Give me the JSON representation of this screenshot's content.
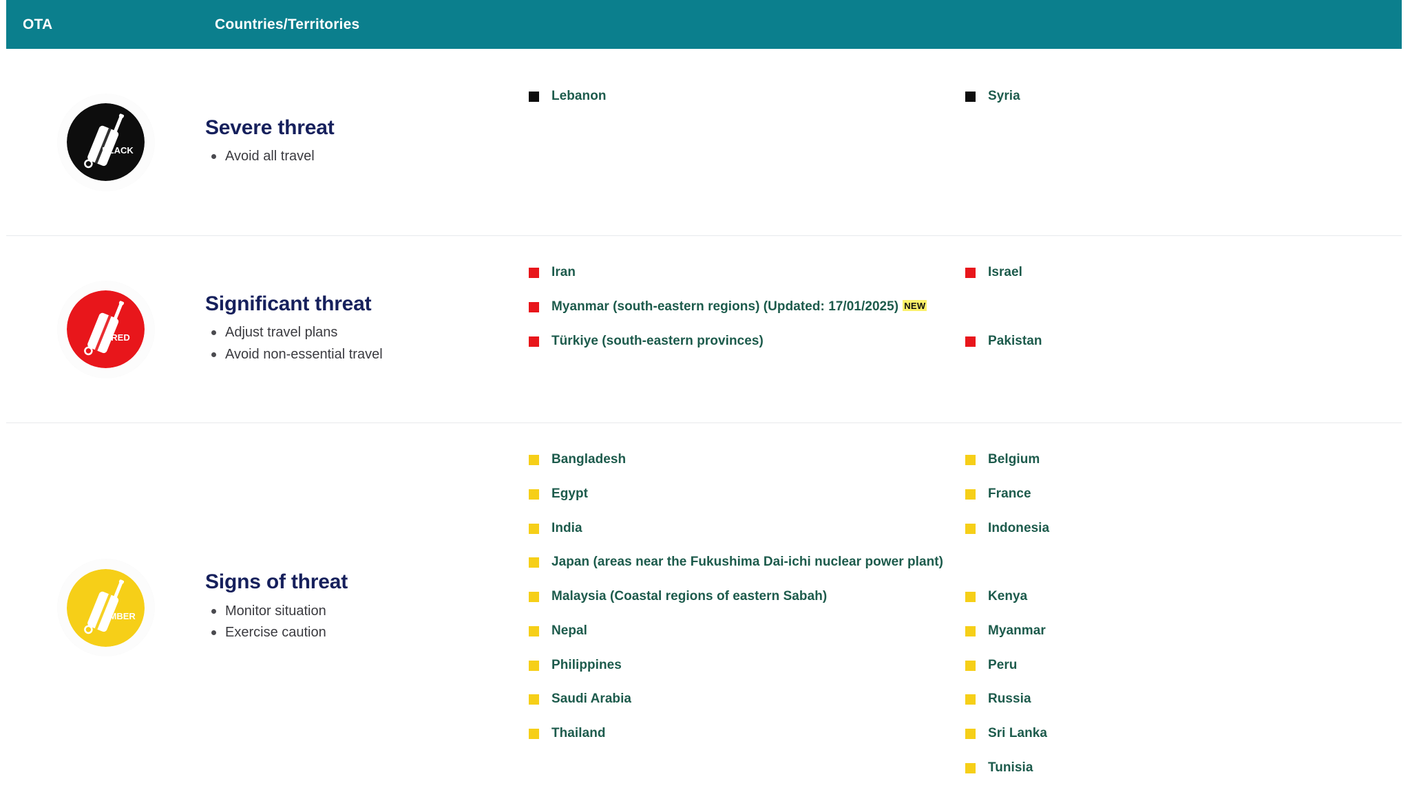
{
  "header": {
    "col_ota": "OTA",
    "col_countries": "Countries/Territories",
    "background_color": "#0b7f8d",
    "text_color": "#ffffff"
  },
  "colors": {
    "teal_header": "#0b7f8d",
    "heading_navy": "#16205c",
    "country_green": "#1d5b4c",
    "black_level": "#0d0d0d",
    "red_level": "#e8161b",
    "amber_level": "#f6cf18",
    "new_badge_highlight": "#faf06a",
    "divider": "#e7e9ec"
  },
  "rows": [
    {
      "id": "severe",
      "icon_name": "ota-badge-black-suitcase-icon",
      "icon_label": "BLACK",
      "icon_color": "#0d0d0d",
      "title": "Severe threat",
      "advice": [
        "Avoid all travel"
      ],
      "marker": "black",
      "columns": [
        {
          "entries": [
            {
              "name": "Lebanon"
            }
          ]
        },
        {
          "entries": [
            {
              "name": "Syria"
            }
          ]
        }
      ]
    },
    {
      "id": "significant",
      "icon_name": "ota-badge-red-suitcase-icon",
      "icon_label": "RED",
      "icon_color": "#e8161b",
      "title": "Significant threat",
      "advice": [
        "Adjust travel plans",
        "Avoid non-essential travel"
      ],
      "marker": "red",
      "columns": [
        {
          "entries": [
            {
              "name": "Iran"
            },
            {
              "name": "Myanmar (south-eastern regions) (Updated: 17/01/2025)",
              "badge": "NEW"
            },
            {
              "name": "Türkiye (south-eastern provinces)"
            }
          ]
        },
        {
          "entries": [
            {
              "name": "Israel"
            },
            {
              "name": "",
              "blank": true
            },
            {
              "name": "Pakistan"
            }
          ]
        }
      ]
    },
    {
      "id": "amber",
      "icon_name": "ota-badge-amber-suitcase-icon",
      "icon_label": "AMBER",
      "icon_color": "#f6cf18",
      "title": "Signs of threat",
      "advice": [
        "Monitor situation",
        "Exercise caution"
      ],
      "marker": "amber",
      "columns": [
        {
          "entries": [
            {
              "name": "Bangladesh"
            },
            {
              "name": "Egypt"
            },
            {
              "name": "India"
            },
            {
              "name": "Japan (areas near the Fukushima Dai-ichi nuclear power plant)"
            },
            {
              "name": "Malaysia (Coastal regions of eastern Sabah)"
            },
            {
              "name": "Nepal"
            },
            {
              "name": "Philippines"
            },
            {
              "name": "Saudi Arabia"
            },
            {
              "name": "Thailand"
            }
          ]
        },
        {
          "entries": [
            {
              "name": "Belgium"
            },
            {
              "name": "France"
            },
            {
              "name": "Indonesia"
            },
            {
              "name": "",
              "blank": true
            },
            {
              "name": "Kenya"
            },
            {
              "name": "Myanmar"
            },
            {
              "name": "Peru"
            },
            {
              "name": "Russia"
            },
            {
              "name": "Sri Lanka"
            },
            {
              "name": "Tunisia"
            }
          ]
        }
      ]
    }
  ]
}
